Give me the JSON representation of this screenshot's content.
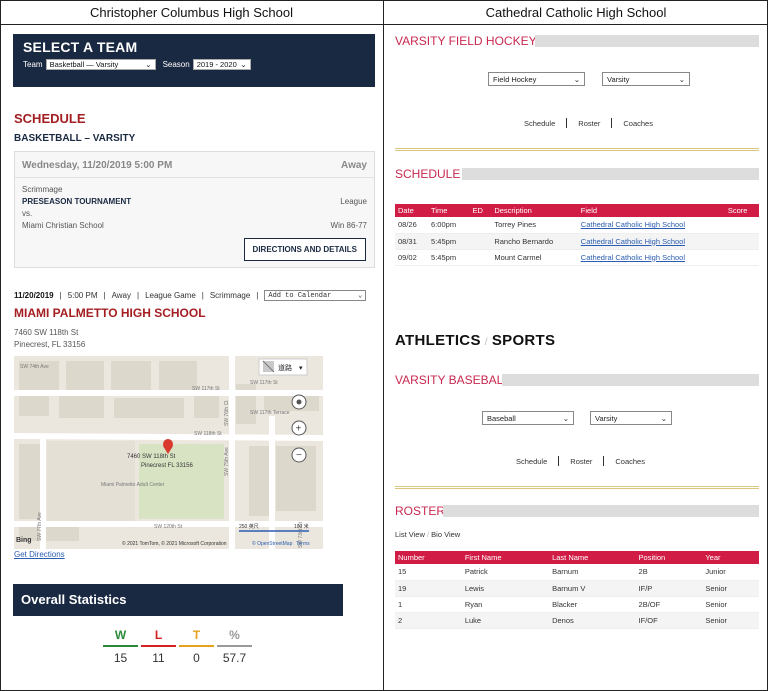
{
  "headers": {
    "left": "Christopher Columbus High School",
    "right": "Cathedral Catholic High School"
  },
  "left": {
    "select_title": "SELECT A TEAM",
    "team_label": "Team",
    "team_value": "Basketball — Varsity",
    "season_label": "Season",
    "season_value": "2019 - 2020",
    "schedule_heading": "SCHEDULE",
    "team_heading": "BASKETBALL – VARSITY",
    "game": {
      "date": "Wednesday, 11/20/2019 5:00 PM",
      "homeaway": "Away",
      "type": "Scrimmage",
      "event": "PRESEASON TOURNAMENT",
      "event_tag": "League",
      "vs": "vs.",
      "opponent": "Miami Christian School",
      "result": "Win 86-77",
      "button": "DIRECTIONS AND DETAILS"
    },
    "meta": {
      "date": "11/20/2019",
      "time": "5:00 PM",
      "homeaway": "Away",
      "league": "League Game",
      "type": "Scrimmage",
      "calendar": "Add to Calendar"
    },
    "venue": "MIAMI PALMETTO HIGH SCHOOL",
    "addr1": "7460 SW 118th St",
    "addr2": "Pinecrest, FL 33156",
    "map": {
      "pin_line1": "7460 SW 118th St",
      "pin_line2": "Pinecrest FL 33156",
      "center_label": "Miami Palmetto Adult Center",
      "street1": "SW 117th St",
      "street2": "SW 117th Terrace",
      "street3": "SW 118th St",
      "street4": "SW 120th St",
      "street5": "SW 77th Ave",
      "street6": "SW 76th Ct",
      "street7": "SW 75th Ave",
      "street8": "SW 74th Ct",
      "street9": "SW 73rd Ct",
      "street10": "SW 74th Ave",
      "street11": "SW 73rd Ave",
      "road_btn": "道路",
      "scale1": "250 英尺",
      "scale2": "100 米",
      "bing": "Bing",
      "copyright": "© 2021 TomTom, © 2021 Microsoft Corporation",
      "osm": "© OpenStreetMap",
      "terms": "Terms"
    },
    "get_directions": "Get Directions",
    "overall": "Overall Statistics",
    "stats": [
      {
        "h": "W",
        "v": "15",
        "color": "#2a8a3a"
      },
      {
        "h": "L",
        "v": "11",
        "color": "#d2231f"
      },
      {
        "h": "T",
        "v": "0",
        "color": "#e6a21a"
      },
      {
        "h": "%",
        "v": "57.7",
        "color": "#999999"
      }
    ]
  },
  "right": {
    "fh_title": "VARSITY FIELD HOCKEY",
    "fh_sport": "Field Hockey",
    "fh_level": "Varsity",
    "nav1": [
      "Schedule",
      "Roster",
      "Coaches"
    ],
    "schedule_title": "SCHEDULE",
    "sched_cols": [
      "Date",
      "Time",
      "ED",
      "Description",
      "Field",
      "Score"
    ],
    "sched_rows": [
      {
        "date": "08/26",
        "time": "6:00pm",
        "ed": "",
        "desc": "Torrey Pines",
        "field": "Cathedral Catholic High School",
        "score": ""
      },
      {
        "date": "08/31",
        "time": "5:45pm",
        "ed": "",
        "desc": "Rancho Bernardo",
        "field": "Cathedral Catholic High School",
        "score": ""
      },
      {
        "date": "09/02",
        "time": "5:45pm",
        "ed": "",
        "desc": "Mount Carmel",
        "field": "Cathedral Catholic High School",
        "score": ""
      }
    ],
    "athletics": "ATHLETICS",
    "sports": "SPORTS",
    "slash": "/",
    "bb_title": "VARSITY BASEBALL",
    "bb_sport": "Baseball",
    "bb_level": "Varsity",
    "nav2": [
      "Schedule",
      "Roster",
      "Coaches"
    ],
    "roster_title": "ROSTER",
    "list_view": "List View",
    "bio_view": "Bio View",
    "view_sep": "/",
    "roster_cols": [
      "Number",
      "First Name",
      "Last Name",
      "Position",
      "Year"
    ],
    "roster_rows": [
      {
        "num": "15",
        "first": "Patrick",
        "last": "Barnum",
        "pos": "2B",
        "year": "Junior"
      },
      {
        "num": "19",
        "first": "Lewis",
        "last": "Barnum V",
        "pos": "IF/P",
        "year": "Senior"
      },
      {
        "num": "1",
        "first": "Ryan",
        "last": "Blacker",
        "pos": "2B/OF",
        "year": "Senior"
      },
      {
        "num": "2",
        "first": "Luke",
        "last": "Denos",
        "pos": "IF/OF",
        "year": "Senior"
      }
    ]
  }
}
